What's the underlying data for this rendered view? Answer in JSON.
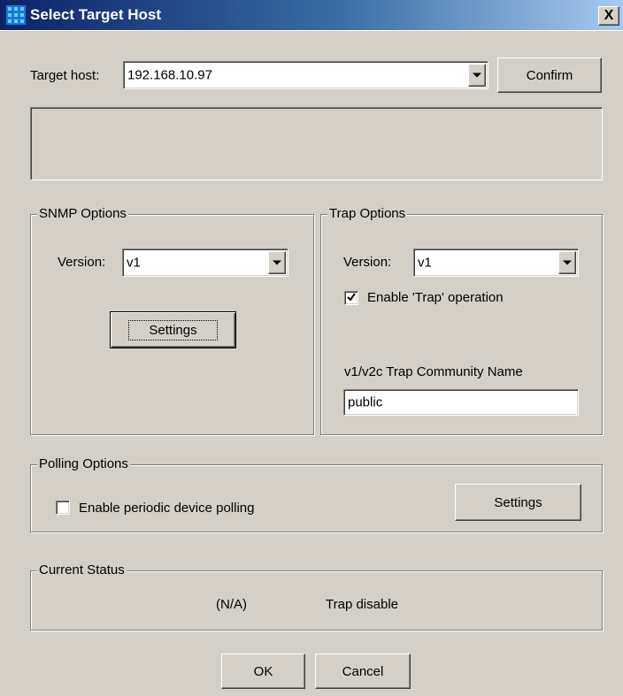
{
  "window": {
    "title": "Select Target Host",
    "close_glyph": "X",
    "icon": "grid-app-icon"
  },
  "target": {
    "label": "Target host:",
    "host_value": "192.168.10.97",
    "confirm_label": "Confirm"
  },
  "snmp": {
    "group_label": "SNMP Options",
    "version_label": "Version:",
    "version_value": "v1",
    "settings_label": "Settings"
  },
  "trap": {
    "group_label": "Trap Options",
    "version_label": "Version:",
    "version_value": "v1",
    "enable_label": "Enable 'Trap' operation",
    "enable_checked": true,
    "community_label": "v1/v2c Trap Community Name",
    "community_value": "public"
  },
  "polling": {
    "group_label": "Polling Options",
    "enable_label": "Enable periodic device polling",
    "enable_checked": false,
    "settings_label": "Settings"
  },
  "status": {
    "group_label": "Current Status",
    "polling_status": "(N/A)",
    "trap_status": "Trap disable"
  },
  "footer": {
    "ok_label": "OK",
    "cancel_label": "Cancel"
  },
  "colors": {
    "dialog_bg": "#d4d0c8",
    "title_bar_start": "#0a246a",
    "title_bar_end": "#a6caf0"
  }
}
